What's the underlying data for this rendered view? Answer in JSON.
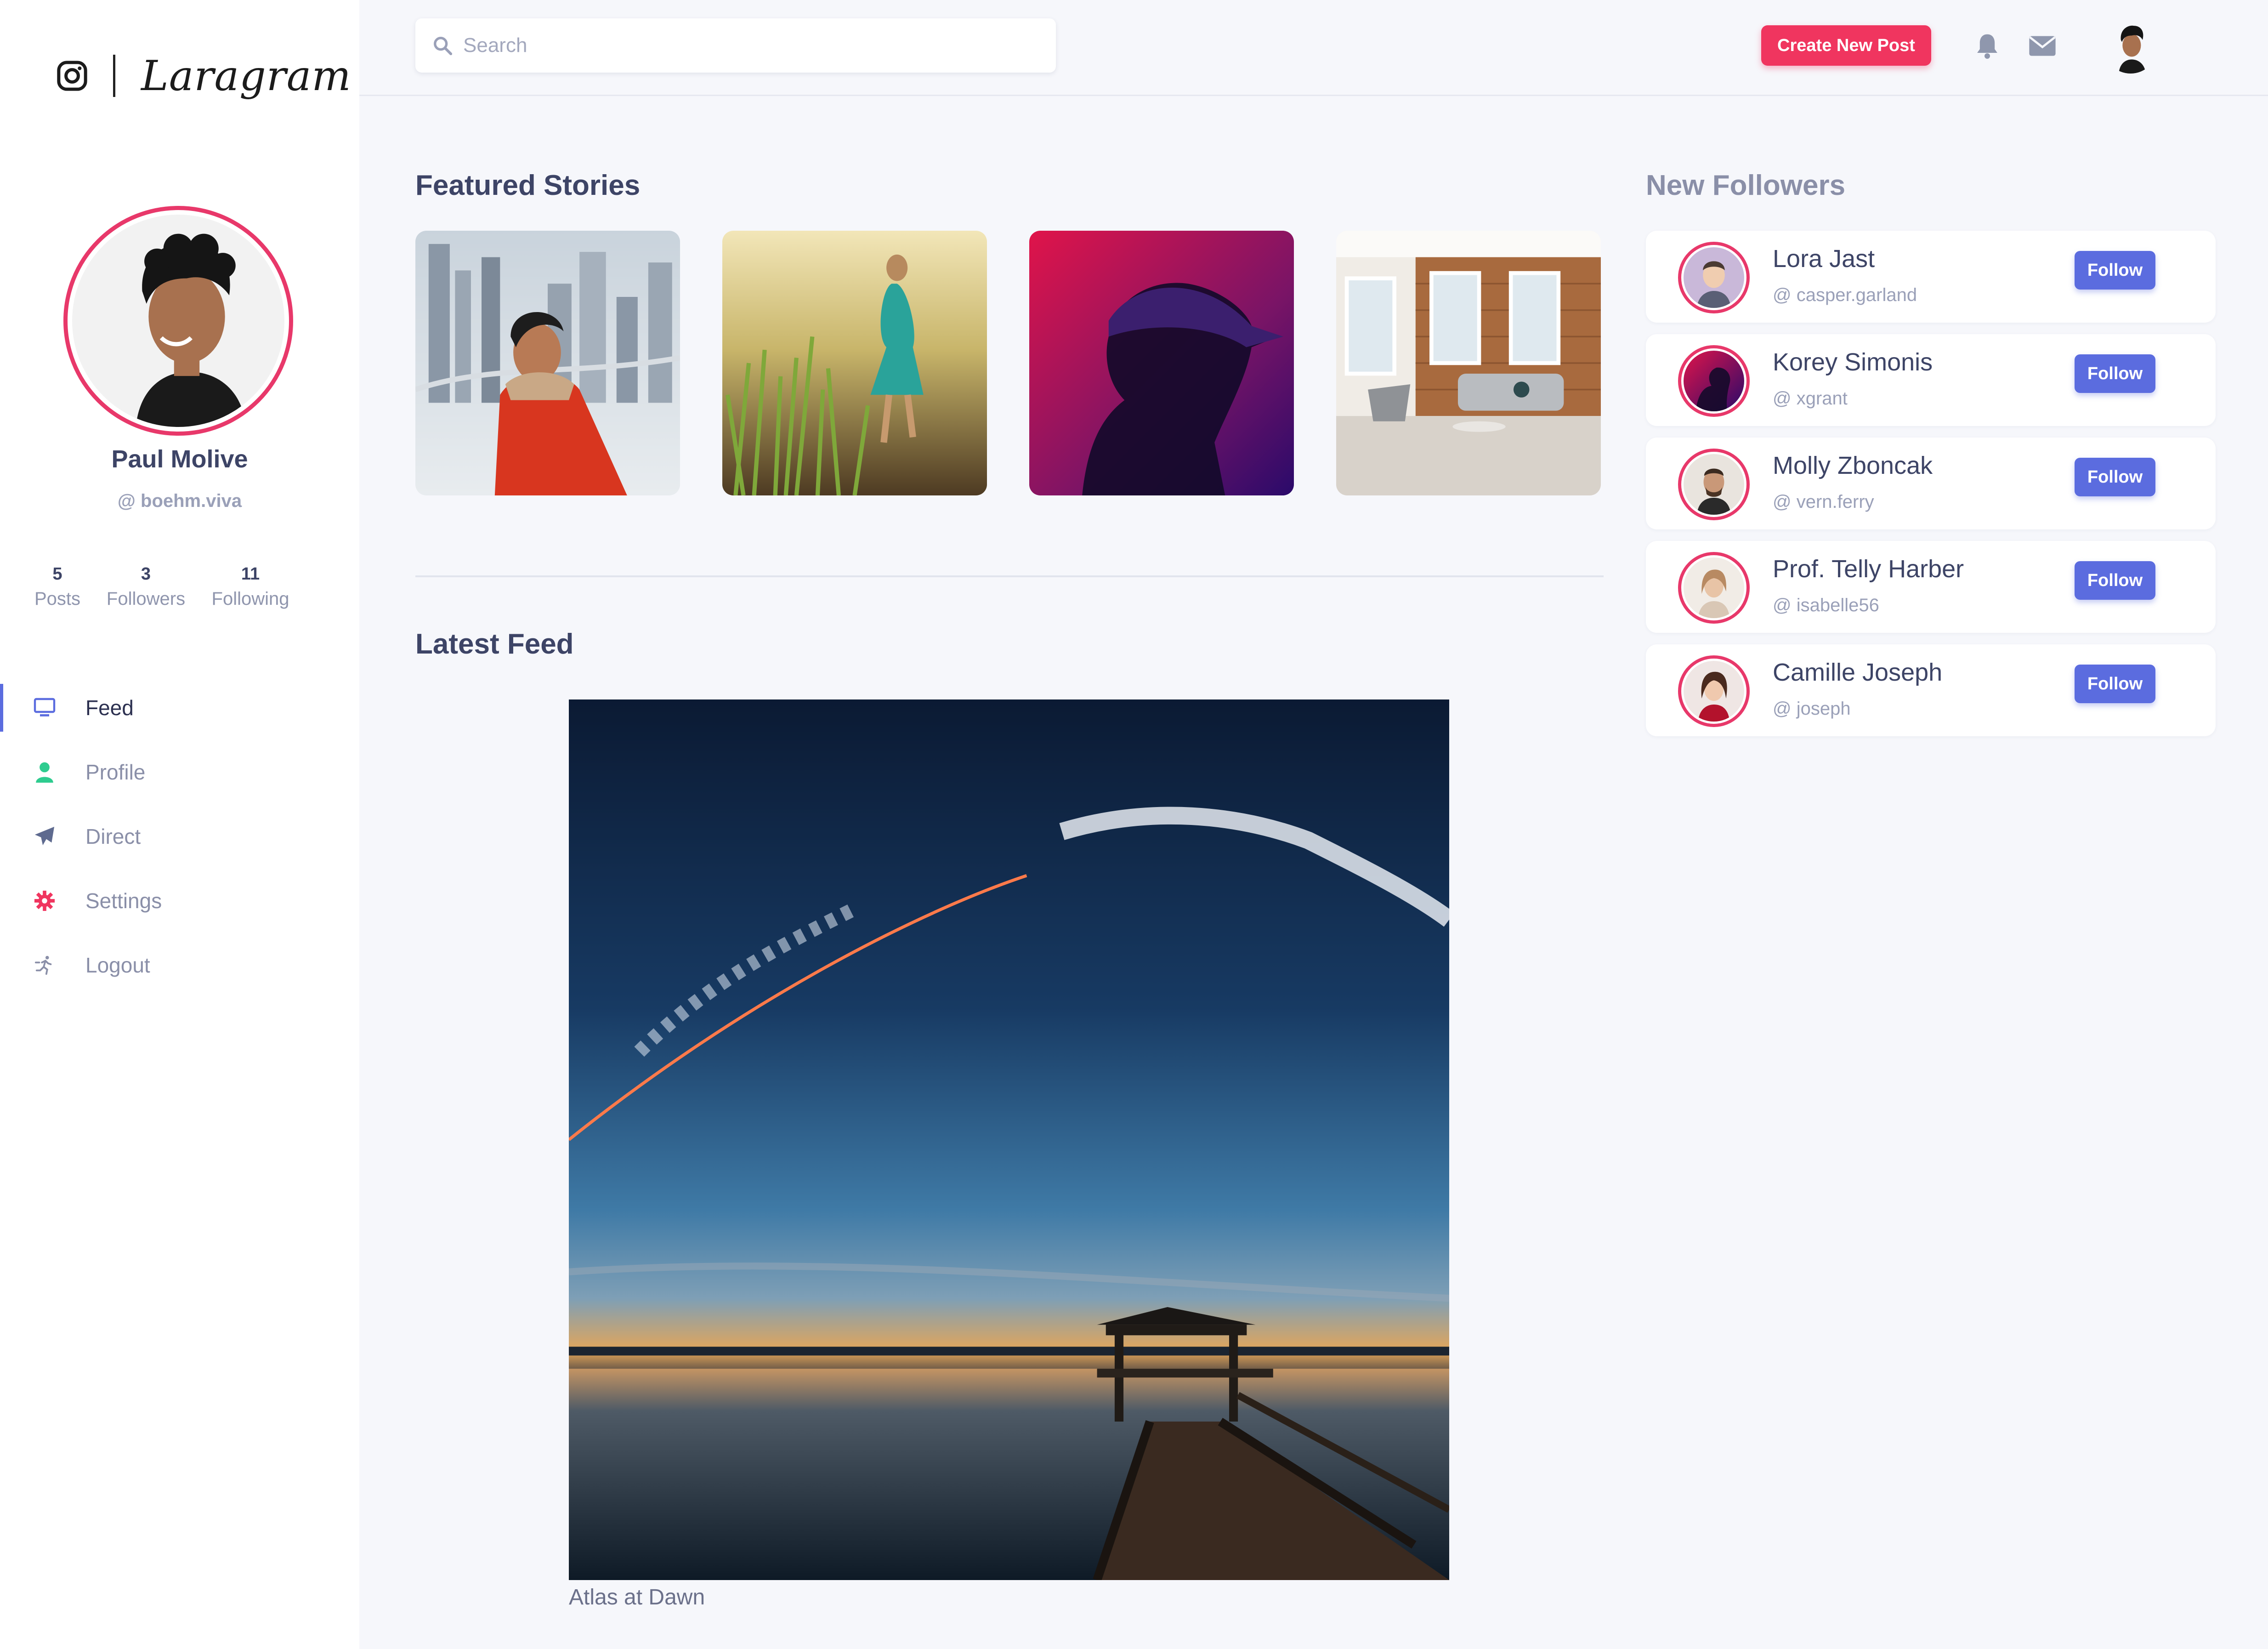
{
  "brand": {
    "name": "Laragram"
  },
  "search": {
    "placeholder": "Search"
  },
  "header": {
    "create_label": "Create New Post"
  },
  "profile": {
    "name": "Paul Molive",
    "handle": "@ boehm.viva",
    "stats": [
      {
        "value": "5",
        "label": "Posts"
      },
      {
        "value": "3",
        "label": "Followers"
      },
      {
        "value": "11",
        "label": "Following"
      }
    ]
  },
  "nav": {
    "items": [
      {
        "label": "Feed",
        "icon": "monitor-icon",
        "active": true
      },
      {
        "label": "Profile",
        "icon": "user-icon"
      },
      {
        "label": "Direct",
        "icon": "paper-plane-icon"
      },
      {
        "label": "Settings",
        "icon": "gear-icon"
      },
      {
        "label": "Logout",
        "icon": "running-person-icon"
      }
    ]
  },
  "stories": {
    "title": "Featured Stories",
    "items": [
      "woman-red-jacket-city",
      "girl-walking-field",
      "neon-profile-cap",
      "living-room-interior"
    ]
  },
  "feed": {
    "title": "Latest Feed",
    "post": {
      "image": "sunset-pier-rocket-launch",
      "caption": "Atlas at Dawn"
    }
  },
  "followers": {
    "title": "New Followers",
    "follow_label": "Follow",
    "items": [
      {
        "name": "Lora Jast",
        "handle": "@ casper.garland"
      },
      {
        "name": "Korey Simonis",
        "handle": "@ xgrant"
      },
      {
        "name": "Molly Zboncak",
        "handle": "@ vern.ferry"
      },
      {
        "name": "Prof. Telly Harber",
        "handle": "@ isabelle56"
      },
      {
        "name": "Camille Joseph",
        "handle": "@ joseph"
      }
    ]
  },
  "colors": {
    "accent": "#5b6cdf",
    "brand_pink": "#f0355f",
    "text_dark": "#3d4466",
    "background": "#f6f7fb"
  }
}
